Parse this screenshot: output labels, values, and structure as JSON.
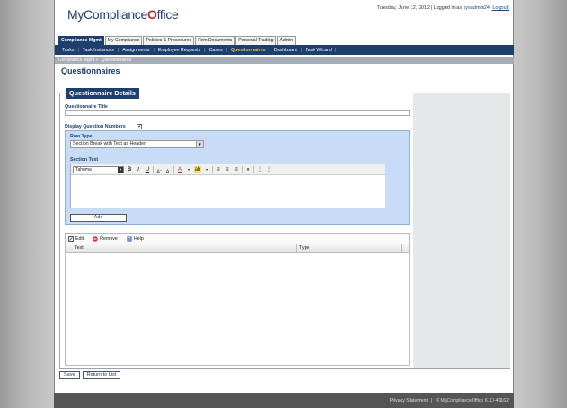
{
  "header": {
    "logo_text": "MyCompliance",
    "logo_check": "O",
    "logo_suffix": "ffice",
    "date": "Tuesday, June 12, 2012",
    "logged_as_prefix": "| Logged in as",
    "username": "sysadmin24",
    "logout": "(Logout)"
  },
  "main_tabs": [
    {
      "label": "Compliance Mgmt",
      "active": true
    },
    {
      "label": "My Compliance"
    },
    {
      "label": "Policies & Procedures"
    },
    {
      "label": "Firm Documents"
    },
    {
      "label": "Personal Trading"
    },
    {
      "label": "Admin"
    }
  ],
  "sub_nav": [
    {
      "label": "Tasks"
    },
    {
      "label": "Task Instances"
    },
    {
      "label": "Assignments"
    },
    {
      "label": "Employee Requests"
    },
    {
      "label": "Cases"
    },
    {
      "label": "Questionnaires",
      "active": true
    },
    {
      "label": "Dashboard"
    },
    {
      "label": "Task Wizard"
    }
  ],
  "breadcrumb": [
    "Compliance Mgmt »",
    "Questionnaires"
  ],
  "page_title": "Questionnaires",
  "form": {
    "legend": "Questionnaire Details",
    "title_label": "Questionnaire Title",
    "title_value": "",
    "display_numbers_label": "Display Question Numbers",
    "display_numbers_checked": "✓",
    "row_type_label": "Row Type",
    "row_type_value": "Section Break with Text as Header",
    "section_text_label": "Section Text",
    "font_value": "Tahoma",
    "add_label": "Add"
  },
  "grid": {
    "edit_label": "Edit",
    "remove_label": "Remove",
    "help_label": "Help",
    "col_text": "Text",
    "col_type": "Type"
  },
  "buttons": {
    "save": "Save",
    "return": "Return to List"
  },
  "footer": {
    "privacy": "Privacy Statement",
    "sep": "|",
    "copyright": "© MyComplianceOffice 6.10-49162"
  },
  "colors": {
    "brand_navy": "#1c3f6e",
    "active_nav": "#e8c93a",
    "form_blue": "#c9dcf7",
    "check_red": "#c0282d"
  }
}
